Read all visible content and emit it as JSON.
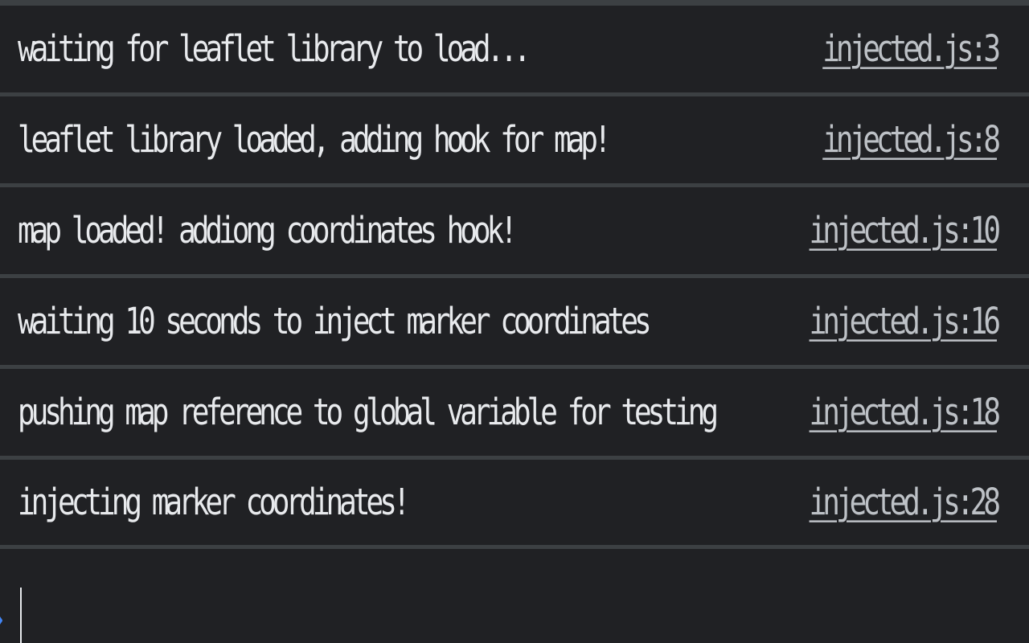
{
  "console": {
    "messages": [
      {
        "text": "waiting for leaflet library to load...",
        "source": "injected.js:3"
      },
      {
        "text": "leaflet library loaded, adding hook for map!",
        "source": "injected.js:8"
      },
      {
        "text": "map loaded! addiong coordinates hook!",
        "source": "injected.js:10"
      },
      {
        "text": "waiting 10 seconds to inject marker coordinates",
        "source": "injected.js:16"
      },
      {
        "text": "pushing map reference to global variable for testing",
        "source": "injected.js:18"
      },
      {
        "text": "injecting marker coordinates!",
        "source": "injected.js:28"
      }
    ],
    "prompt": {
      "icon": "chevron-right-icon",
      "value": ""
    }
  },
  "colors": {
    "background": "#202124",
    "divider": "#3c4043",
    "text": "#e8eaed",
    "link": "#bdc1c6",
    "prompt_accent": "#4285f4"
  }
}
